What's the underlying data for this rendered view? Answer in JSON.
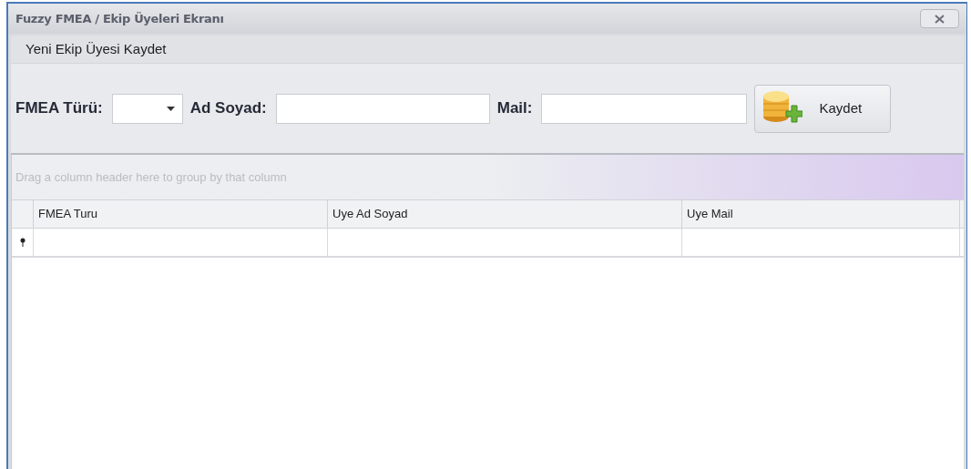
{
  "window": {
    "title": "Fuzzy FMEA / Ekip Üyeleri Ekranı"
  },
  "group": {
    "title": "Yeni Ekip Üyesi Kaydet",
    "fields": [
      {
        "kind": "dropdown",
        "label": "FMEA Türü:"
      },
      {
        "kind": "text",
        "label": "Ad Soyad:"
      },
      {
        "kind": "text",
        "label": "Mail:"
      }
    ],
    "button": {
      "label": "Kaydet"
    }
  },
  "grid": {
    "group_panel_hint": "Drag a column header here to group by that column",
    "columns": [
      "FMEA Turu",
      "Uye Ad Soyad",
      "Uye Mail"
    ]
  }
}
